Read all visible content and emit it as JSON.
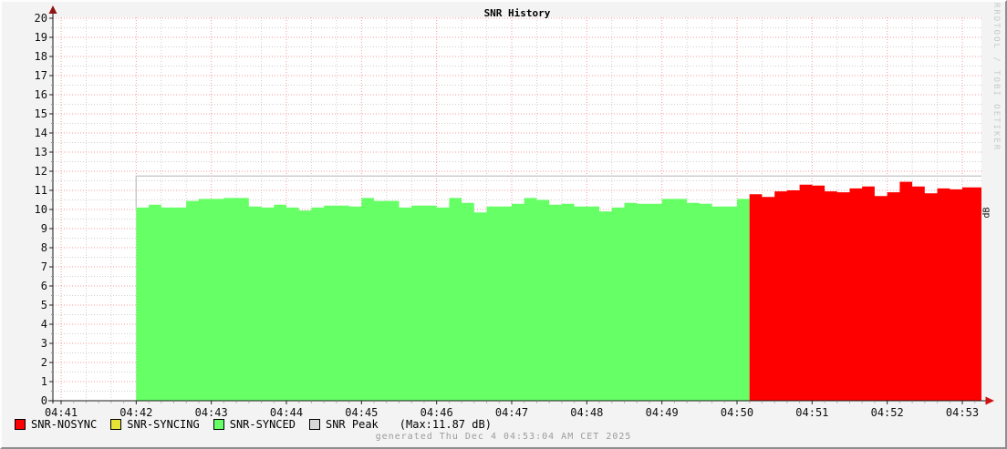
{
  "title": "SNR History",
  "watermark": "RRDTOOL / TOBI OETIKER",
  "right_axis_label": "dB",
  "footer": "generated Thu Dec  4 04:53:04 AM CET 2025",
  "legend": {
    "items": [
      {
        "label": "SNR-NOSYNC",
        "color": "#ff0000"
      },
      {
        "label": "SNR-SYNCING",
        "color": "#e8e337"
      },
      {
        "label": "SNR-SYNCED",
        "color": "#66ff66"
      },
      {
        "label": "SNR Peak",
        "color": "#d8d8d8"
      }
    ],
    "max_note": "(Max:11.87 dB)"
  },
  "chart_data": {
    "type": "area",
    "title": "SNR History",
    "ylabel_right": "dB",
    "ylim": [
      0,
      20
    ],
    "y_major_step": 1,
    "y_minor_step": 0.5,
    "grid": "on",
    "legend_position": "bottom",
    "x_tick_labels": [
      "04:41",
      "04:42",
      "04:43",
      "04:44",
      "04:45",
      "04:46",
      "04:47",
      "04:48",
      "04:49",
      "04:50",
      "04:51",
      "04:52",
      "04:53"
    ],
    "y_tick_labels": [
      "0",
      "1",
      "2",
      "3",
      "4",
      "5",
      "6",
      "7",
      "8",
      "9",
      "10",
      "11",
      "12",
      "13",
      "14",
      "15",
      "16",
      "17",
      "18",
      "19",
      "20"
    ],
    "bar_seconds": 10,
    "data_start": "04:42:00",
    "data_start_offset_min": 1.0,
    "series": [
      {
        "name": "SNR-SYNCED",
        "color": "#66ff66",
        "start_offset_min": 1.0,
        "values": [
          10.1,
          10.25,
          10.1,
          10.1,
          10.45,
          10.55,
          10.55,
          10.6,
          10.6,
          10.15,
          10.1,
          10.25,
          10.1,
          9.95,
          10.1,
          10.2,
          10.2,
          10.15,
          10.6,
          10.45,
          10.45,
          10.1,
          10.2,
          10.2,
          10.1,
          10.6,
          10.35,
          9.85,
          10.15,
          10.15,
          10.3,
          10.6,
          10.5,
          10.25,
          10.3,
          10.15,
          10.15,
          9.9,
          10.1,
          10.35,
          10.3,
          10.3,
          10.55,
          10.55,
          10.35,
          10.3,
          10.15,
          10.15,
          10.55
        ]
      },
      {
        "name": "SNR-NOSYNC",
        "color": "#ff0000",
        "start_offset_min": 9.1667,
        "values": [
          10.8,
          10.65,
          10.95,
          11.0,
          11.3,
          11.25,
          10.95,
          10.9,
          11.1,
          11.2,
          10.7,
          10.9,
          11.45,
          11.2,
          10.85,
          11.1,
          11.05,
          11.15,
          11.15
        ]
      },
      {
        "name": "SNR-SYNCING",
        "color": "#e8e337",
        "start_offset_min": null,
        "values": []
      }
    ],
    "peak": {
      "name": "SNR Peak",
      "line_value": 11.75,
      "max_value": 11.87,
      "color": "#c8c8c8"
    },
    "colors": {
      "grid_major": "#f59b9b",
      "grid_minor": "#d0d0d0",
      "axis": "#1a1a1a",
      "arrow_y": "#8f1515",
      "arrow_x": "#cf1010",
      "canvas": "#ffffff",
      "background": "#f3f3f3"
    }
  }
}
